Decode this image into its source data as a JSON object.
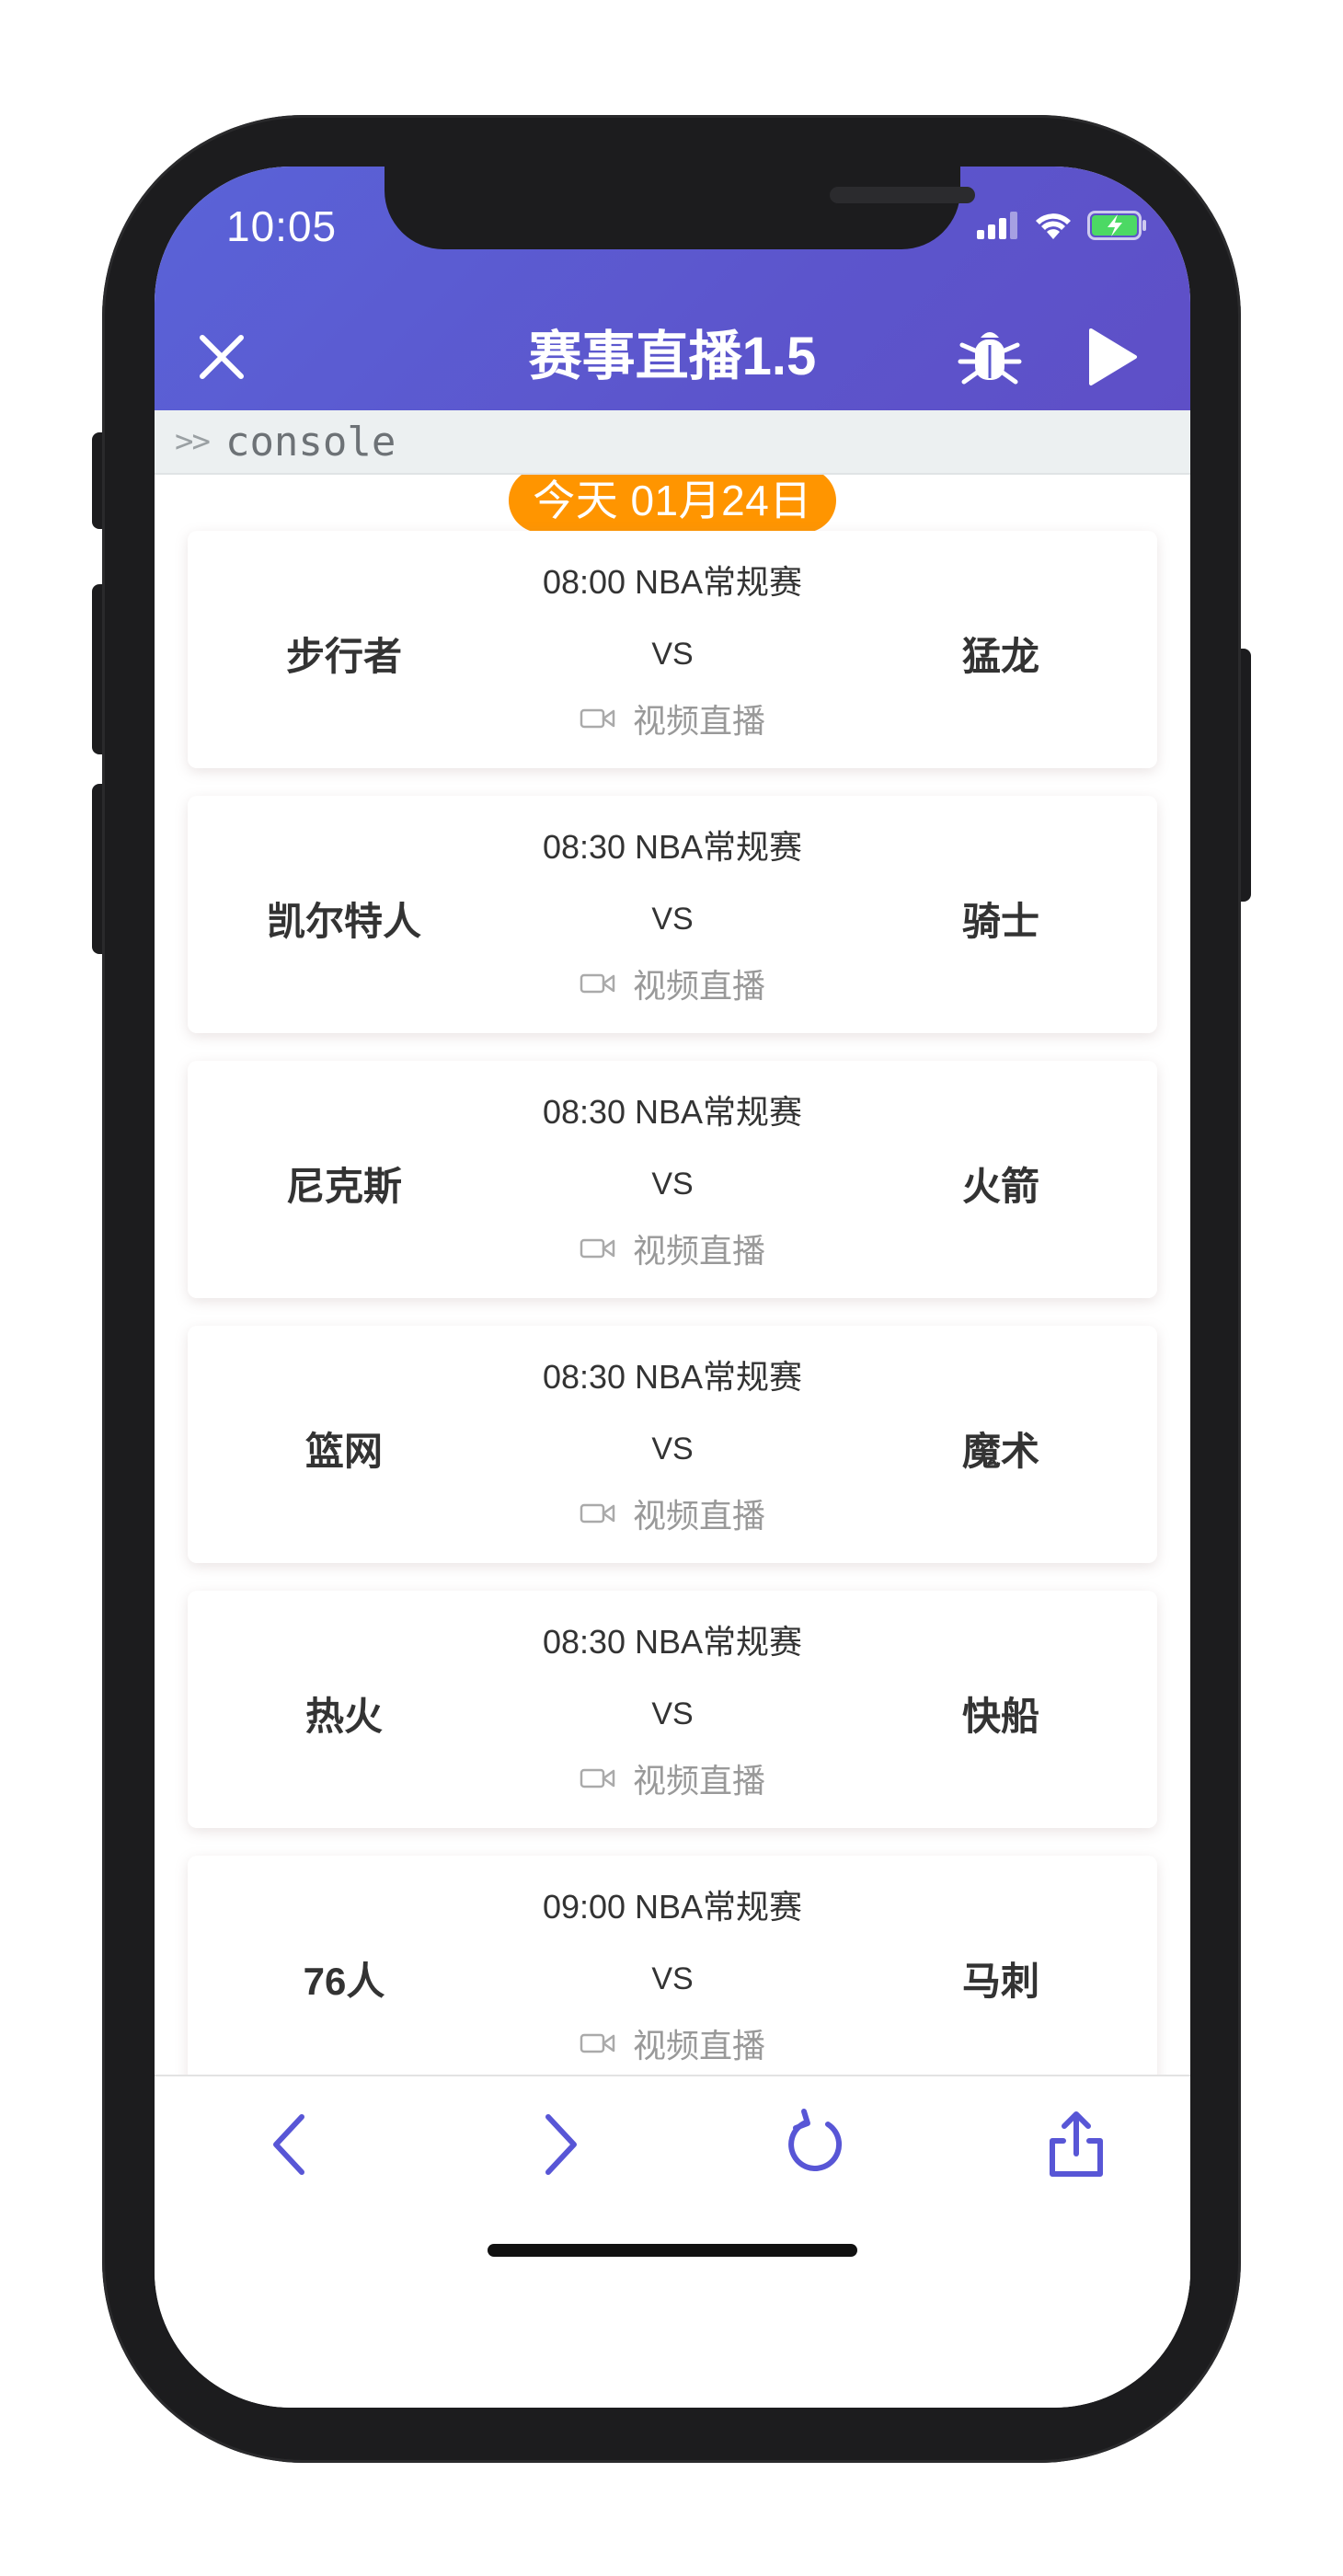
{
  "status_bar": {
    "time": "10:05",
    "icons": [
      "signal-icon",
      "wifi-icon",
      "battery-charging-icon"
    ]
  },
  "nav": {
    "title": "赛事直播1.5",
    "close_icon": "close-icon",
    "debug_icon": "bug-icon",
    "play_icon": "play-icon"
  },
  "console": {
    "prompt": ">>",
    "label": "console"
  },
  "schedule": {
    "date_label": "今天 01月24日",
    "live_label": "视频直播",
    "vs_label": "VS",
    "matches": [
      {
        "meta": "08:00 NBA常规赛",
        "home": "步行者",
        "away": "猛龙"
      },
      {
        "meta": "08:30 NBA常规赛",
        "home": "凯尔特人",
        "away": "骑士"
      },
      {
        "meta": "08:30 NBA常规赛",
        "home": "尼克斯",
        "away": "火箭"
      },
      {
        "meta": "08:30 NBA常规赛",
        "home": "篮网",
        "away": "魔术"
      },
      {
        "meta": "08:30 NBA常规赛",
        "home": "热火",
        "away": "快船"
      },
      {
        "meta": "09:00 NBA常规赛",
        "home": "76人",
        "away": "马刺"
      }
    ]
  },
  "toolbar": {
    "icons": [
      "back-icon",
      "forward-icon",
      "refresh-icon",
      "share-icon"
    ]
  },
  "colors": {
    "header_gradient_start": "#5a63d8",
    "header_gradient_end": "#5e4fc7",
    "accent": "#5856d6",
    "date_pill": "#ff9500",
    "battery": "#4cd964"
  }
}
